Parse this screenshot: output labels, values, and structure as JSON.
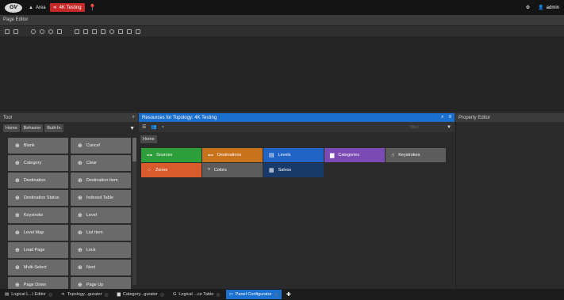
{
  "topbar": {
    "logo_text": "GV",
    "crumbs": [
      {
        "label": "Area",
        "icon": "area-icon"
      },
      {
        "label": "4K Testing",
        "icon": "share-icon"
      }
    ],
    "user": "admin",
    "colors": {
      "active_crumb": "#c62828"
    }
  },
  "page_editor": {
    "title": "Page Editor"
  },
  "tool_panel": {
    "title": "Tool",
    "tabs": [
      "Home",
      "Behavior",
      "Built-In"
    ],
    "buttons": [
      "Blank",
      "Cancel",
      "Category",
      "Clear",
      "Destination",
      "Destination Item",
      "Destination Status",
      "Indexed Table",
      "Keystroke",
      "Level",
      "Level Map",
      "List Item",
      "Load Page",
      "Lock",
      "Multi-Select",
      "Next",
      "Page Down",
      "Page Up"
    ]
  },
  "resources_panel": {
    "title": "Resources for Topology: 4K Testing",
    "filter_placeholder": "filter",
    "home_tab": "Home",
    "buttons": [
      {
        "label": "Sources",
        "color": "#2e9e3a",
        "icon": "sources-icon"
      },
      {
        "label": "Destinations",
        "color": "#c8731c",
        "icon": "destinations-icon"
      },
      {
        "label": "Levels",
        "color": "#1f63c4",
        "icon": "levels-icon"
      },
      {
        "label": "Categories",
        "color": "#7b4bb3",
        "icon": "categories-icon"
      },
      {
        "label": "Keystrokes",
        "color": "#5c5c5c",
        "icon": "keystrokes-icon"
      },
      {
        "label": "Zones",
        "color": "#d95b2b",
        "icon": "zones-icon"
      },
      {
        "label": "Colors",
        "color": "#5c5c5c",
        "icon": "colors-icon"
      },
      {
        "label": "Salvos",
        "color": "#173a6b",
        "icon": "salvos-icon"
      }
    ]
  },
  "property_panel": {
    "title": "Property Editor"
  },
  "statusbar": {
    "tabs": [
      {
        "label": "Logical L...l Editor",
        "active": false
      },
      {
        "label": "Topology...gurator",
        "active": false
      },
      {
        "label": "Category...gurator",
        "active": false
      },
      {
        "label": "Logical ...ce Table",
        "active": false
      },
      {
        "label": "Panel Configurator",
        "active": true
      }
    ],
    "accent": "#1b6fcf"
  }
}
